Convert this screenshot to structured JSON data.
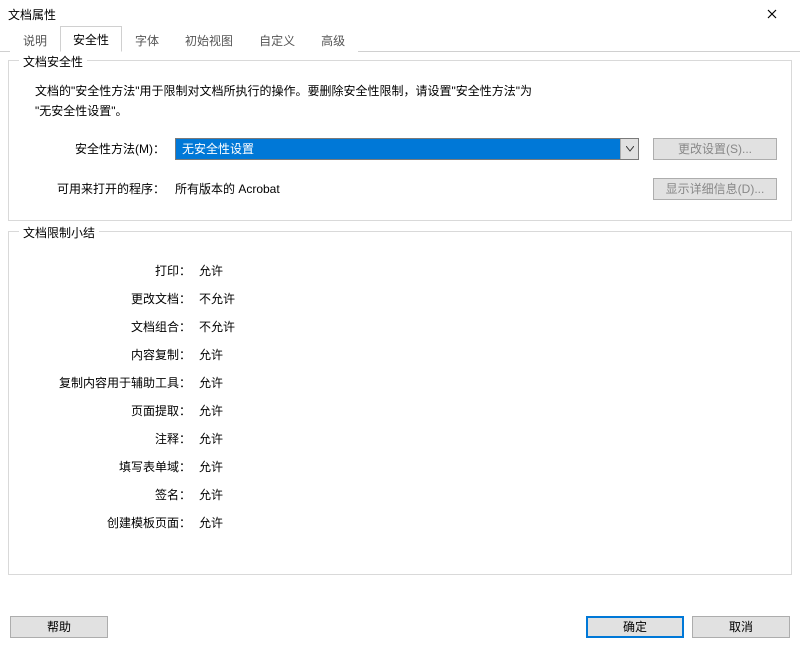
{
  "window": {
    "title": "文档属性"
  },
  "tabs": {
    "t0": "说明",
    "t1": "安全性",
    "t2": "字体",
    "t3": "初始视图",
    "t4": "自定义",
    "t5": "高级"
  },
  "group_security": {
    "legend": "文档安全性",
    "desc_line1": "文档的\"安全性方法\"用于限制对文档所执行的操作。要删除安全性限制，请设置\"安全性方法\"为",
    "desc_line2": "\"无安全性设置\"。",
    "method_label": "安全性方法(M)：",
    "method_value": "无安全性设置",
    "opener_label": "可用来打开的程序：",
    "opener_value": "所有版本的 Acrobat",
    "btn_change": "更改设置(S)...",
    "btn_details": "显示详细信息(D)..."
  },
  "group_restrict": {
    "legend": "文档限制小结",
    "rows": [
      {
        "label": "打印：",
        "value": "允许"
      },
      {
        "label": "更改文档：",
        "value": "不允许"
      },
      {
        "label": "文档组合：",
        "value": "不允许"
      },
      {
        "label": "内容复制：",
        "value": "允许"
      },
      {
        "label": "复制内容用于辅助工具：",
        "value": "允许"
      },
      {
        "label": "页面提取：",
        "value": "允许"
      },
      {
        "label": "注释：",
        "value": "允许"
      },
      {
        "label": "填写表单域：",
        "value": "允许"
      },
      {
        "label": "签名：",
        "value": "允许"
      },
      {
        "label": "创建模板页面：",
        "value": "允许"
      }
    ]
  },
  "footer": {
    "help": "帮助",
    "ok": "确定",
    "cancel": "取消"
  }
}
